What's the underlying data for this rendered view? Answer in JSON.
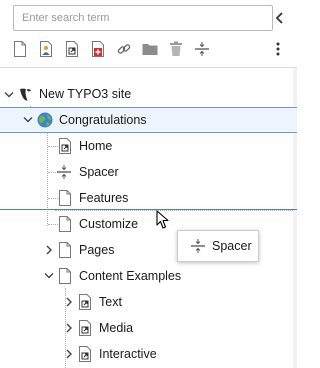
{
  "search": {
    "placeholder": "Enter search term"
  },
  "toolbar": {
    "items": [
      {
        "name": "new-page-icon",
        "label": ""
      },
      {
        "name": "backend-user-section-icon",
        "label": ""
      },
      {
        "name": "shortcut-page-icon",
        "label": ""
      },
      {
        "name": "mountpoint-page-icon",
        "label": ""
      },
      {
        "name": "link-page-icon",
        "label": ""
      },
      {
        "name": "folder-icon",
        "label": ""
      },
      {
        "name": "recycler-icon",
        "label": ""
      },
      {
        "name": "spacer-icon",
        "label": ""
      }
    ]
  },
  "tree": {
    "root": "New TYPO3 site",
    "congratulations": "Congratulations",
    "home": "Home",
    "spacer": "Spacer",
    "features": "Features",
    "customize": "Customize",
    "pages": "Pages",
    "content_examples": "Content Examples",
    "text": "Text",
    "media": "Media",
    "interactive": "Interactive"
  },
  "drag_tooltip": {
    "label": "Spacer",
    "icon": "spacer-icon"
  },
  "colors": {
    "selection_border": "#6a9ad6",
    "selection_bg": "#eef4fb",
    "typo3_orange": "#f49700",
    "mountpoint_red": "#d92e2e"
  }
}
